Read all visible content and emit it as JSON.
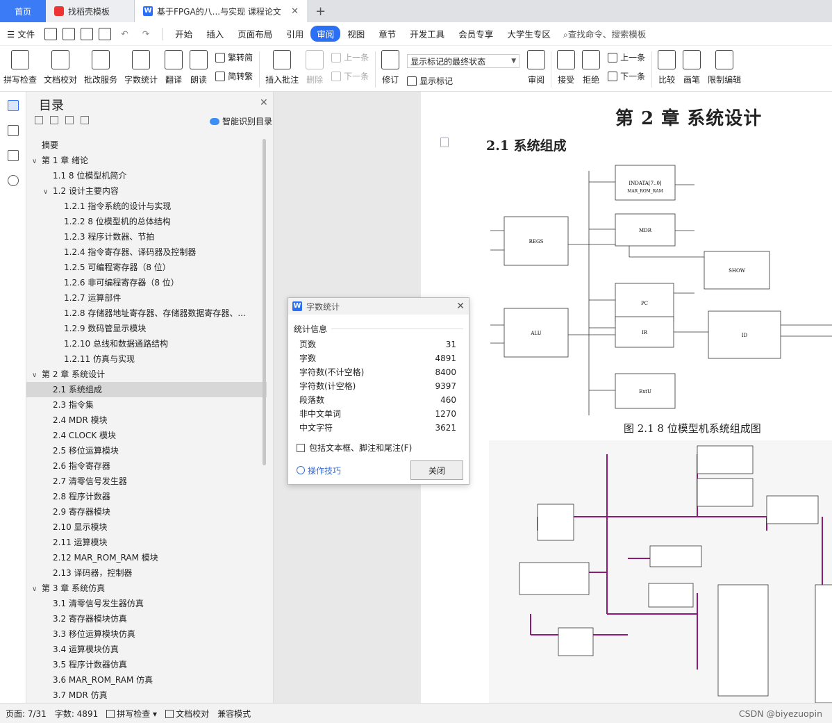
{
  "tabs": {
    "home": "首页",
    "templates": "找稻壳模板",
    "doc": "基于FPGA的八...与实现 课程论文"
  },
  "menu": [
    "文件",
    "开始",
    "插入",
    "页面布局",
    "引用",
    "审阅",
    "视图",
    "章节",
    "开发工具",
    "会员专享",
    "大学生专区"
  ],
  "search_text": "查找命令、搜索模板",
  "ribbon": {
    "spell": "拼写检查",
    "proofread": "文档校对",
    "batch": "批改服务",
    "wordcount": "字数统计",
    "translate": "翻译",
    "read": "朗读",
    "trad": "繁转简",
    "simp": "简转繁",
    "insert_comment": "插入批注",
    "delete": "删除",
    "prev": "上一条",
    "next": "下一条",
    "revise": "修订",
    "markup_state": "显示标记的最终状态",
    "show_markup": "显示标记",
    "review": "审阅",
    "accept": "接受",
    "reject": "拒绝",
    "prev2": "上一条",
    "next2": "下一条",
    "compare": "比较",
    "pen": "画笔",
    "restrict": "限制编辑"
  },
  "toc": {
    "title": "目录",
    "smart": "智能识别目录",
    "items": [
      {
        "level": 0,
        "text": "摘要",
        "caret": ""
      },
      {
        "level": 0,
        "text": "第 1 章  绪论",
        "caret": "∨"
      },
      {
        "level": 1,
        "text": "1.1 8 位模型机简介",
        "caret": ""
      },
      {
        "level": 1,
        "text": "1.2 设计主要内容",
        "caret": "∨"
      },
      {
        "level": 2,
        "text": "1.2.1  指令系统的设计与实现",
        "caret": ""
      },
      {
        "level": 2,
        "text": "1.2.2 8 位模型机的总体结构",
        "caret": ""
      },
      {
        "level": 2,
        "text": "1.2.3  程序计数器、节拍",
        "caret": ""
      },
      {
        "level": 2,
        "text": "1.2.4  指令寄存器、译码器及控制器",
        "caret": ""
      },
      {
        "level": 2,
        "text": "1.2.5  可编程寄存器（8 位）",
        "caret": ""
      },
      {
        "level": 2,
        "text": "1.2.6  非可编程寄存器（8 位）",
        "caret": ""
      },
      {
        "level": 2,
        "text": "1.2.7  运算部件",
        "caret": ""
      },
      {
        "level": 2,
        "text": "1.2.8  存储器地址寄存器、存储器数据寄存器、...",
        "caret": ""
      },
      {
        "level": 2,
        "text": "1.2.9  数码管显示模块",
        "caret": ""
      },
      {
        "level": 2,
        "text": "1.2.10  总线和数据通路结构",
        "caret": ""
      },
      {
        "level": 2,
        "text": "1.2.11  仿真与实现",
        "caret": ""
      },
      {
        "level": 0,
        "text": "第 2 章  系统设计",
        "caret": "∨"
      },
      {
        "level": 1,
        "text": "2.1 系统组成",
        "caret": "",
        "selected": true
      },
      {
        "level": 1,
        "text": "2.3  指令集",
        "caret": ""
      },
      {
        "level": 1,
        "text": "2.4 MDR 模块",
        "caret": ""
      },
      {
        "level": 1,
        "text": "2.4 CLOCK 模块",
        "caret": ""
      },
      {
        "level": 1,
        "text": "2.5  移位运算模块",
        "caret": ""
      },
      {
        "level": 1,
        "text": "2.6  指令寄存器",
        "caret": ""
      },
      {
        "level": 1,
        "text": "2.7  清零信号发生器",
        "caret": ""
      },
      {
        "level": 1,
        "text": "2.8  程序计数器",
        "caret": ""
      },
      {
        "level": 1,
        "text": "2.9  寄存器模块",
        "caret": ""
      },
      {
        "level": 1,
        "text": "2.10  显示模块",
        "caret": ""
      },
      {
        "level": 1,
        "text": "2.11  运算模块",
        "caret": ""
      },
      {
        "level": 1,
        "text": "2.12 MAR_ROM_RAM 模块",
        "caret": ""
      },
      {
        "level": 1,
        "text": "2.13  译码器，控制器",
        "caret": ""
      },
      {
        "level": 0,
        "text": "第 3 章  系统仿真",
        "caret": "∨"
      },
      {
        "level": 1,
        "text": "3.1  清零信号发生器仿真",
        "caret": ""
      },
      {
        "level": 1,
        "text": "3.2  寄存器模块仿真",
        "caret": ""
      },
      {
        "level": 1,
        "text": "3.3  移位运算模块仿真",
        "caret": ""
      },
      {
        "level": 1,
        "text": "3.4  运算模块仿真",
        "caret": ""
      },
      {
        "level": 1,
        "text": "3.5  程序计数器仿真",
        "caret": ""
      },
      {
        "level": 1,
        "text": "3.6 MAR_ROM_RAM 仿真",
        "caret": ""
      },
      {
        "level": 1,
        "text": "3.7 MDR 仿真",
        "caret": ""
      }
    ]
  },
  "doc": {
    "chapter": "第 2 章  系统设计",
    "section": "2.1 系统组成",
    "figure_caption": "图 2.1  8 位模型机系统组成图",
    "blocks": [
      {
        "name": "INDATA[7..0]",
        "sub": "MAR_ROM_RAM"
      },
      {
        "name": "REGS",
        "sub": ""
      },
      {
        "name": "MDR",
        "sub": ""
      },
      {
        "name": "SHOW",
        "sub": ""
      },
      {
        "name": "PC",
        "sub": ""
      },
      {
        "name": "ALU",
        "sub": ""
      },
      {
        "name": "IR",
        "sub": ""
      },
      {
        "name": "ID",
        "sub": ""
      },
      {
        "name": "ExtU",
        "sub": ""
      }
    ]
  },
  "dialog": {
    "title": "字数统计",
    "section": "统计信息",
    "stats": [
      {
        "label": "页数",
        "value": "31"
      },
      {
        "label": "字数",
        "value": "4891"
      },
      {
        "label": "字符数(不计空格)",
        "value": "8400"
      },
      {
        "label": "字符数(计空格)",
        "value": "9397"
      },
      {
        "label": "段落数",
        "value": "460"
      },
      {
        "label": "非中文单词",
        "value": "1270"
      },
      {
        "label": "中文字符",
        "value": "3621"
      }
    ],
    "checkbox": "包括文本框、脚注和尾注(F)",
    "tips": "操作技巧",
    "close": "关闭"
  },
  "status": {
    "page": "页面: 7/31",
    "words": "字数: 4891",
    "spell": "拼写检查",
    "proof": "文档校对",
    "compat": "兼容模式",
    "watermark": "CSDN @biyezuopin"
  },
  "colors": {
    "accent": "#2b6ff5",
    "schematic_bus": "#8b1a7a"
  }
}
